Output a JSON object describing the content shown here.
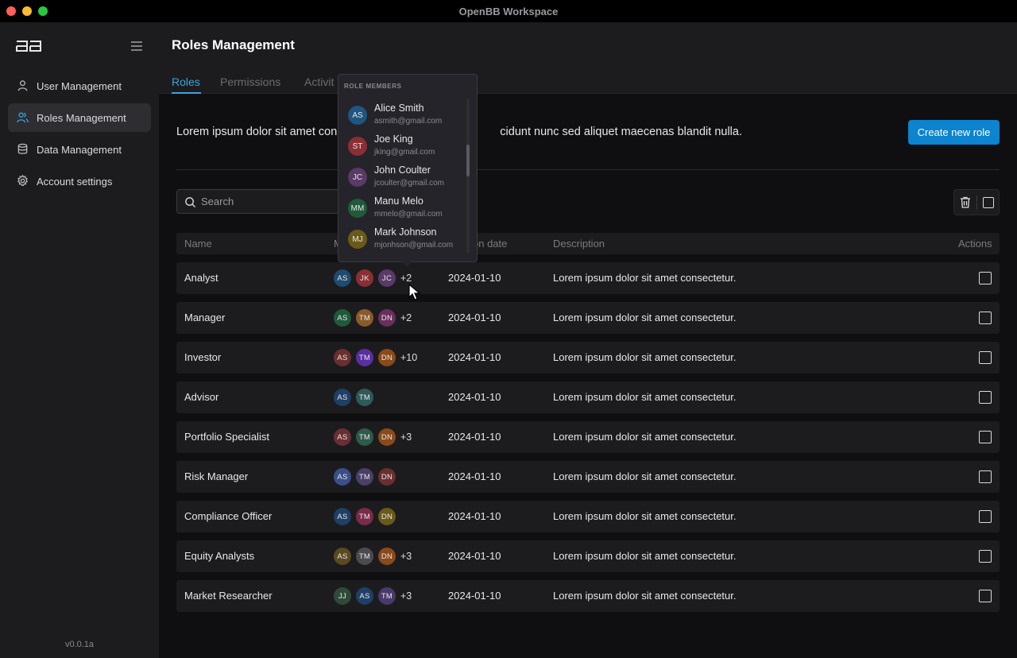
{
  "window": {
    "title": "OpenBB Workspace"
  },
  "sidebar": {
    "items": [
      {
        "label": "User Management",
        "icon": "user-icon"
      },
      {
        "label": "Roles Management",
        "icon": "users-icon",
        "active": true
      },
      {
        "label": "Data Management",
        "icon": "database-icon"
      },
      {
        "label": "Account settings",
        "icon": "gear-icon"
      }
    ],
    "version": "v0.0.1a"
  },
  "header": {
    "title": "Roles Management",
    "tabs": [
      "Roles",
      "Permissions",
      "Activit"
    ]
  },
  "main": {
    "description": "Lorem ipsum dolor sit amet con                              cidunt nunc sed aliquet maecenas blandit nulla.",
    "description_left": "Lorem ipsum dolor sit amet con",
    "description_right": "cidunt nunc sed aliquet maecenas blandit nulla.",
    "create_button": "Create new role",
    "search_placeholder": "Search"
  },
  "table": {
    "headers": {
      "name": "Name",
      "members": "M",
      "date": "on date",
      "description": "Description",
      "actions": "Actions"
    },
    "rows": [
      {
        "name": "Analyst",
        "members": [
          [
            "AS",
            "#1f4b6e"
          ],
          [
            "JK",
            "#8a2f33"
          ],
          [
            "JC",
            "#5a3a66"
          ]
        ],
        "more": "+2",
        "date": "2024-01-10",
        "description": "Lorem ipsum dolor sit amet consectetur."
      },
      {
        "name": "Manager",
        "members": [
          [
            "AS",
            "#1f5a3a"
          ],
          [
            "TM",
            "#8a5a2a"
          ],
          [
            "DN",
            "#6a2f5a"
          ]
        ],
        "more": "+2",
        "date": "2024-01-10",
        "description": "Lorem ipsum dolor sit amet consectetur."
      },
      {
        "name": "Investor",
        "members": [
          [
            "AS",
            "#6a2f2f"
          ],
          [
            "TM",
            "#5a2fa0"
          ],
          [
            "DN",
            "#8a4a1a"
          ]
        ],
        "more": "+10",
        "date": "2024-01-10",
        "description": "Lorem ipsum dolor sit amet consectetur."
      },
      {
        "name": "Advisor",
        "members": [
          [
            "AS",
            "#1f3f66"
          ],
          [
            "TM",
            "#2f5a5a"
          ]
        ],
        "more": "",
        "date": "2024-01-10",
        "description": "Lorem ipsum dolor sit amet consectetur."
      },
      {
        "name": "Portfolio Specialist",
        "members": [
          [
            "AS",
            "#6a2f33"
          ],
          [
            "TM",
            "#2f5a4a"
          ],
          [
            "DN",
            "#8a4a1a"
          ]
        ],
        "more": "+3",
        "date": "2024-01-10",
        "description": "Lorem ipsum dolor sit amet consectetur."
      },
      {
        "name": "Risk Manager",
        "members": [
          [
            "AS",
            "#3a4f8a"
          ],
          [
            "TM",
            "#4a3f66"
          ],
          [
            "DN",
            "#6a2f2f"
          ]
        ],
        "more": "",
        "date": "2024-01-10",
        "description": "Lorem ipsum dolor sit amet consectetur."
      },
      {
        "name": "Compliance Officer",
        "members": [
          [
            "AS",
            "#1f3f66"
          ],
          [
            "TM",
            "#7a2a4a"
          ],
          [
            "DN",
            "#6a5a1a"
          ]
        ],
        "more": "",
        "date": "2024-01-10",
        "description": "Lorem ipsum dolor sit amet consectetur."
      },
      {
        "name": "Equity Analysts",
        "members": [
          [
            "AS",
            "#5a4a1f"
          ],
          [
            "TM",
            "#4a4a50"
          ],
          [
            "DN",
            "#8a4a1a"
          ]
        ],
        "more": "+3",
        "date": "2024-01-10",
        "description": "Lorem ipsum dolor sit amet consectetur."
      },
      {
        "name": "Market Researcher",
        "members": [
          [
            "JJ",
            "#2f4a3a"
          ],
          [
            "AS",
            "#1f3f66"
          ],
          [
            "TM",
            "#4a3a6a"
          ]
        ],
        "more": "+3",
        "date": "2024-01-10",
        "description": "Lorem ipsum dolor sit amet consectetur."
      }
    ]
  },
  "popover": {
    "title": "ROLE MEMBERS",
    "members": [
      {
        "initials": "AS",
        "name": "Alice Smith",
        "email": "asmith@gmail.com",
        "color": "#1f5580"
      },
      {
        "initials": "ST",
        "name": "Joe King",
        "email": "jking@gmail.com",
        "color": "#8a2f33"
      },
      {
        "initials": "JC",
        "name": "John Coulter",
        "email": "jcoulter@gmail.com",
        "color": "#5a3a66"
      },
      {
        "initials": "MM",
        "name": "Manu Melo",
        "email": "mmelo@gmail.com",
        "color": "#1f5a3a"
      },
      {
        "initials": "MJ",
        "name": "Mark Johnson",
        "email": "mjonhson@gmail.com",
        "color": "#6a5a1a"
      }
    ]
  },
  "colors": {
    "accent": "#3aa3e0",
    "button": "#0c84cf",
    "panel": "#1c1c1f",
    "background": "#0f0f11"
  }
}
